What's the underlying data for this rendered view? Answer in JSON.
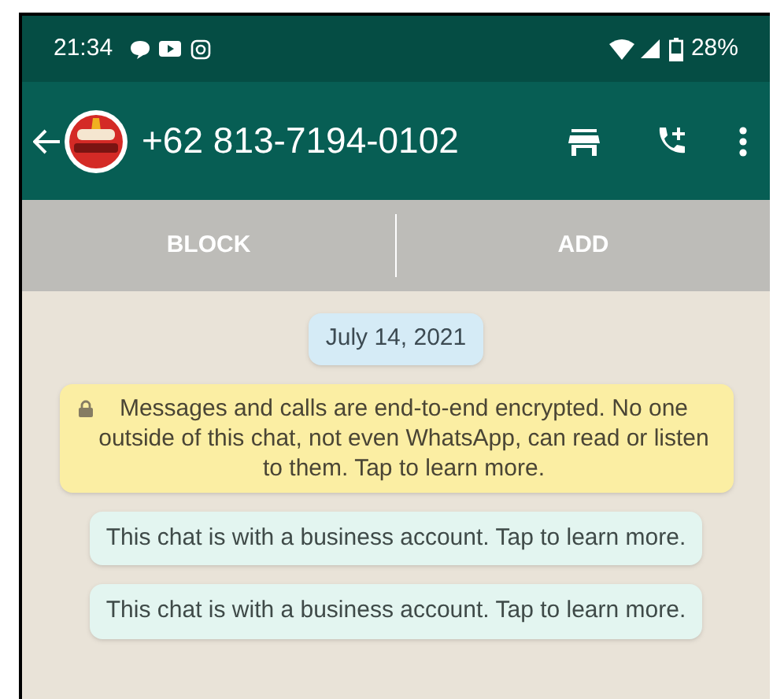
{
  "status_bar": {
    "time": "21:34",
    "battery": "28%"
  },
  "header": {
    "title": "+62 813-7194-0102"
  },
  "action_bar": {
    "buttons": [
      "BLOCK",
      "ADD"
    ]
  },
  "messages": [
    {
      "kind": "date",
      "text": "July 14, 2021"
    },
    {
      "kind": "encryption",
      "text": "Messages and calls are end-to-end encrypted. No one outside of this chat, not even WhatsApp, can read or listen to them. Tap to learn more."
    },
    {
      "kind": "business",
      "text": "This chat is with a business account. Tap to learn more."
    },
    {
      "kind": "business",
      "text": "This chat is with a business account. Tap to learn more."
    }
  ]
}
